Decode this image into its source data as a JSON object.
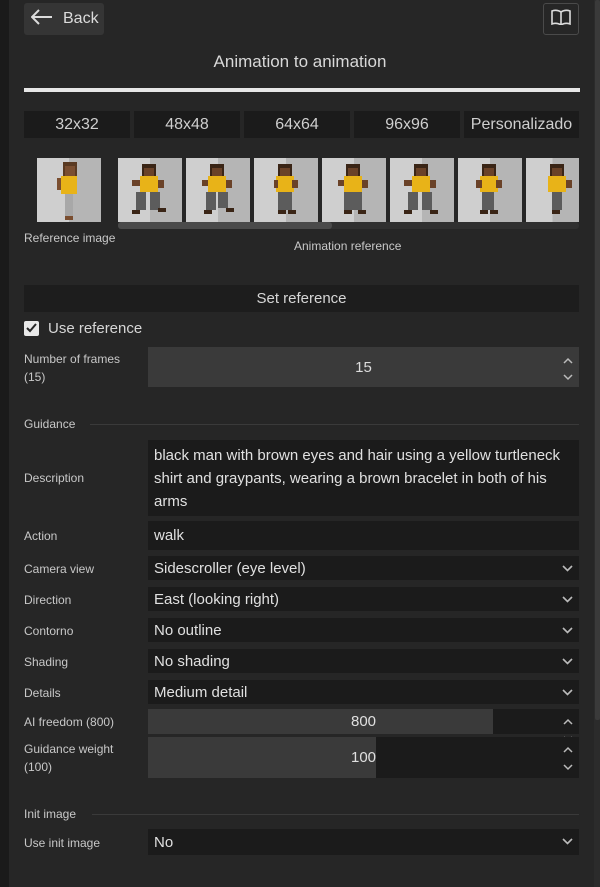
{
  "header": {
    "back_label": "Back",
    "title": "Animation to animation"
  },
  "sizes": [
    "32x32",
    "48x48",
    "64x64",
    "96x96",
    "Personalizado"
  ],
  "reference": {
    "reference_image_label": "Reference image",
    "animation_reference_label": "Animation reference",
    "set_reference_label": "Set reference",
    "use_reference_label": "Use reference",
    "use_reference_checked": true
  },
  "frames": {
    "label": "Number of frames (15)",
    "value": "15"
  },
  "guidance": {
    "section_label": "Guidance",
    "description_label": "Description",
    "description_value": "black man with brown eyes and hair using a yellow turtleneck shirt and graypants, wearing a brown bracelet in both of his arms",
    "action_label": "Action",
    "action_value": "walk",
    "camera_label": "Camera view",
    "camera_value": "Sidescroller (eye level)",
    "direction_label": "Direction",
    "direction_value": "East (looking right)",
    "outline_label": "Contorno",
    "outline_value": "No outline",
    "shading_label": "Shading",
    "shading_value": "No shading",
    "details_label": "Details",
    "details_value": "Medium detail",
    "freedom_label": "AI freedom (800)",
    "freedom_value": "800",
    "freedom_fraction": 0.8,
    "weight_label": "Guidance weight (100)",
    "weight_value": "100",
    "weight_fraction": 0.53
  },
  "init": {
    "section_label": "Init image",
    "use_init_label": "Use init image",
    "use_init_value": "No"
  },
  "colors": {
    "background": "#262626",
    "field_dark": "#1b1b1b",
    "field_light": "#3a3a3a",
    "shirt_yellow": "#e8b318"
  }
}
